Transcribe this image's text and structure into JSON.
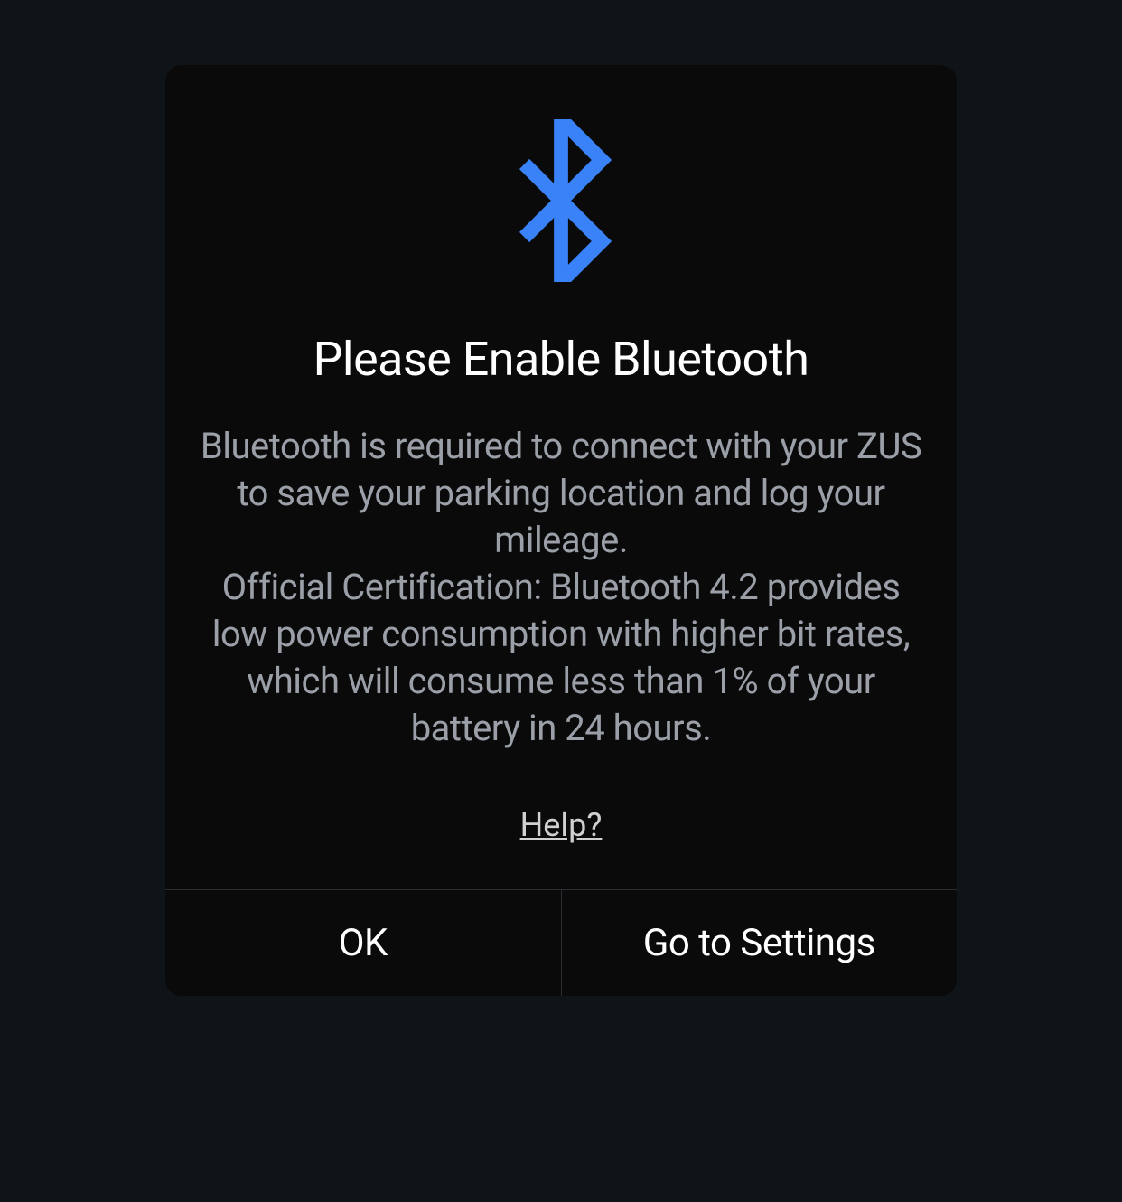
{
  "dialog": {
    "title": "Please Enable Bluetooth",
    "body_line1": "Bluetooth is required to connect with your ZUS to save your parking location and log your mileage.",
    "body_line2": "Official Certification: Bluetooth 4.2 provides low power consumption with higher bit rates, which will consume less than 1% of your battery in 24 hours.",
    "help_label": "Help?",
    "buttons": {
      "ok": "OK",
      "settings": "Go to Settings"
    },
    "icon_color": "#3a82f7"
  }
}
